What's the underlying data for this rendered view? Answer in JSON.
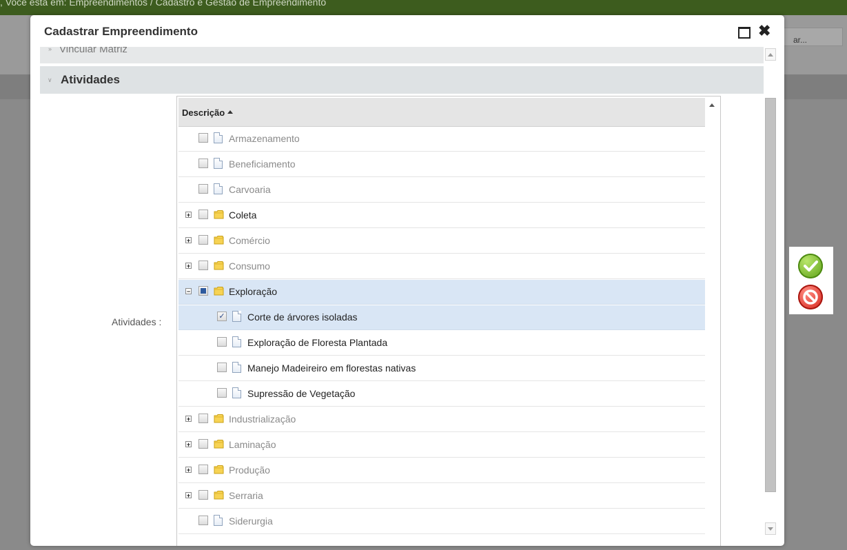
{
  "background": {
    "breadcrumb": ", Você está em: Empreendimentos / Cadastro e Gestão de Empreendimento",
    "search_label": "ar..."
  },
  "modal": {
    "title": "Cadastrar Empreendimento",
    "panel_vincular": "Vincular Matriz",
    "panel_atividades": "Atividades",
    "field_label": "Atividades :",
    "grid_header": "Descrição"
  },
  "rows": [
    {
      "label": "Armazenamento",
      "kind": "doc",
      "level": 0,
      "expandable": false,
      "checked": "none",
      "enabled": false
    },
    {
      "label": "Beneficiamento",
      "kind": "doc",
      "level": 0,
      "expandable": false,
      "checked": "none",
      "enabled": false
    },
    {
      "label": "Carvoaria",
      "kind": "doc",
      "level": 0,
      "expandable": false,
      "checked": "none",
      "enabled": false
    },
    {
      "label": "Coleta",
      "kind": "folder",
      "level": 0,
      "expandable": true,
      "expanded": false,
      "checked": "none",
      "enabled": true
    },
    {
      "label": "Comércio",
      "kind": "folder",
      "level": 0,
      "expandable": true,
      "expanded": false,
      "checked": "none",
      "enabled": false
    },
    {
      "label": "Consumo",
      "kind": "folder",
      "level": 0,
      "expandable": true,
      "expanded": false,
      "checked": "none",
      "enabled": false
    },
    {
      "label": "Exploração",
      "kind": "folder",
      "level": 0,
      "expandable": true,
      "expanded": true,
      "checked": "partial",
      "enabled": true,
      "selected": true
    },
    {
      "label": "Corte de árvores isoladas",
      "kind": "doc",
      "level": 1,
      "expandable": false,
      "checked": "full",
      "enabled": true,
      "selected": true
    },
    {
      "label": "Exploração de Floresta Plantada",
      "kind": "doc",
      "level": 1,
      "expandable": false,
      "checked": "none",
      "enabled": true
    },
    {
      "label": "Manejo Madeireiro em florestas nativas",
      "kind": "doc",
      "level": 1,
      "expandable": false,
      "checked": "none",
      "enabled": true
    },
    {
      "label": "Supressão de Vegetação",
      "kind": "doc",
      "level": 1,
      "expandable": false,
      "checked": "none",
      "enabled": true
    },
    {
      "label": "Industrialização",
      "kind": "folder",
      "level": 0,
      "expandable": true,
      "expanded": false,
      "checked": "none",
      "enabled": false
    },
    {
      "label": "Laminação",
      "kind": "folder",
      "level": 0,
      "expandable": true,
      "expanded": false,
      "checked": "none",
      "enabled": false
    },
    {
      "label": "Produção",
      "kind": "folder",
      "level": 0,
      "expandable": true,
      "expanded": false,
      "checked": "none",
      "enabled": false
    },
    {
      "label": "Serraria",
      "kind": "folder",
      "level": 0,
      "expandable": true,
      "expanded": false,
      "checked": "none",
      "enabled": false
    },
    {
      "label": "Siderurgia",
      "kind": "doc",
      "level": 0,
      "expandable": false,
      "checked": "none",
      "enabled": false
    }
  ],
  "colors": {
    "selected_row": "#d9e6f5",
    "disabled_text": "#8a8a8a",
    "enabled_text": "#222222",
    "folder": "#f2c230",
    "confirm": "#5a9e14",
    "cancel": "#d4241b"
  },
  "icons": {
    "confirm": "check-circle-icon",
    "cancel": "no-entry-icon",
    "folder": "folder-icon",
    "doc": "document-icon"
  }
}
